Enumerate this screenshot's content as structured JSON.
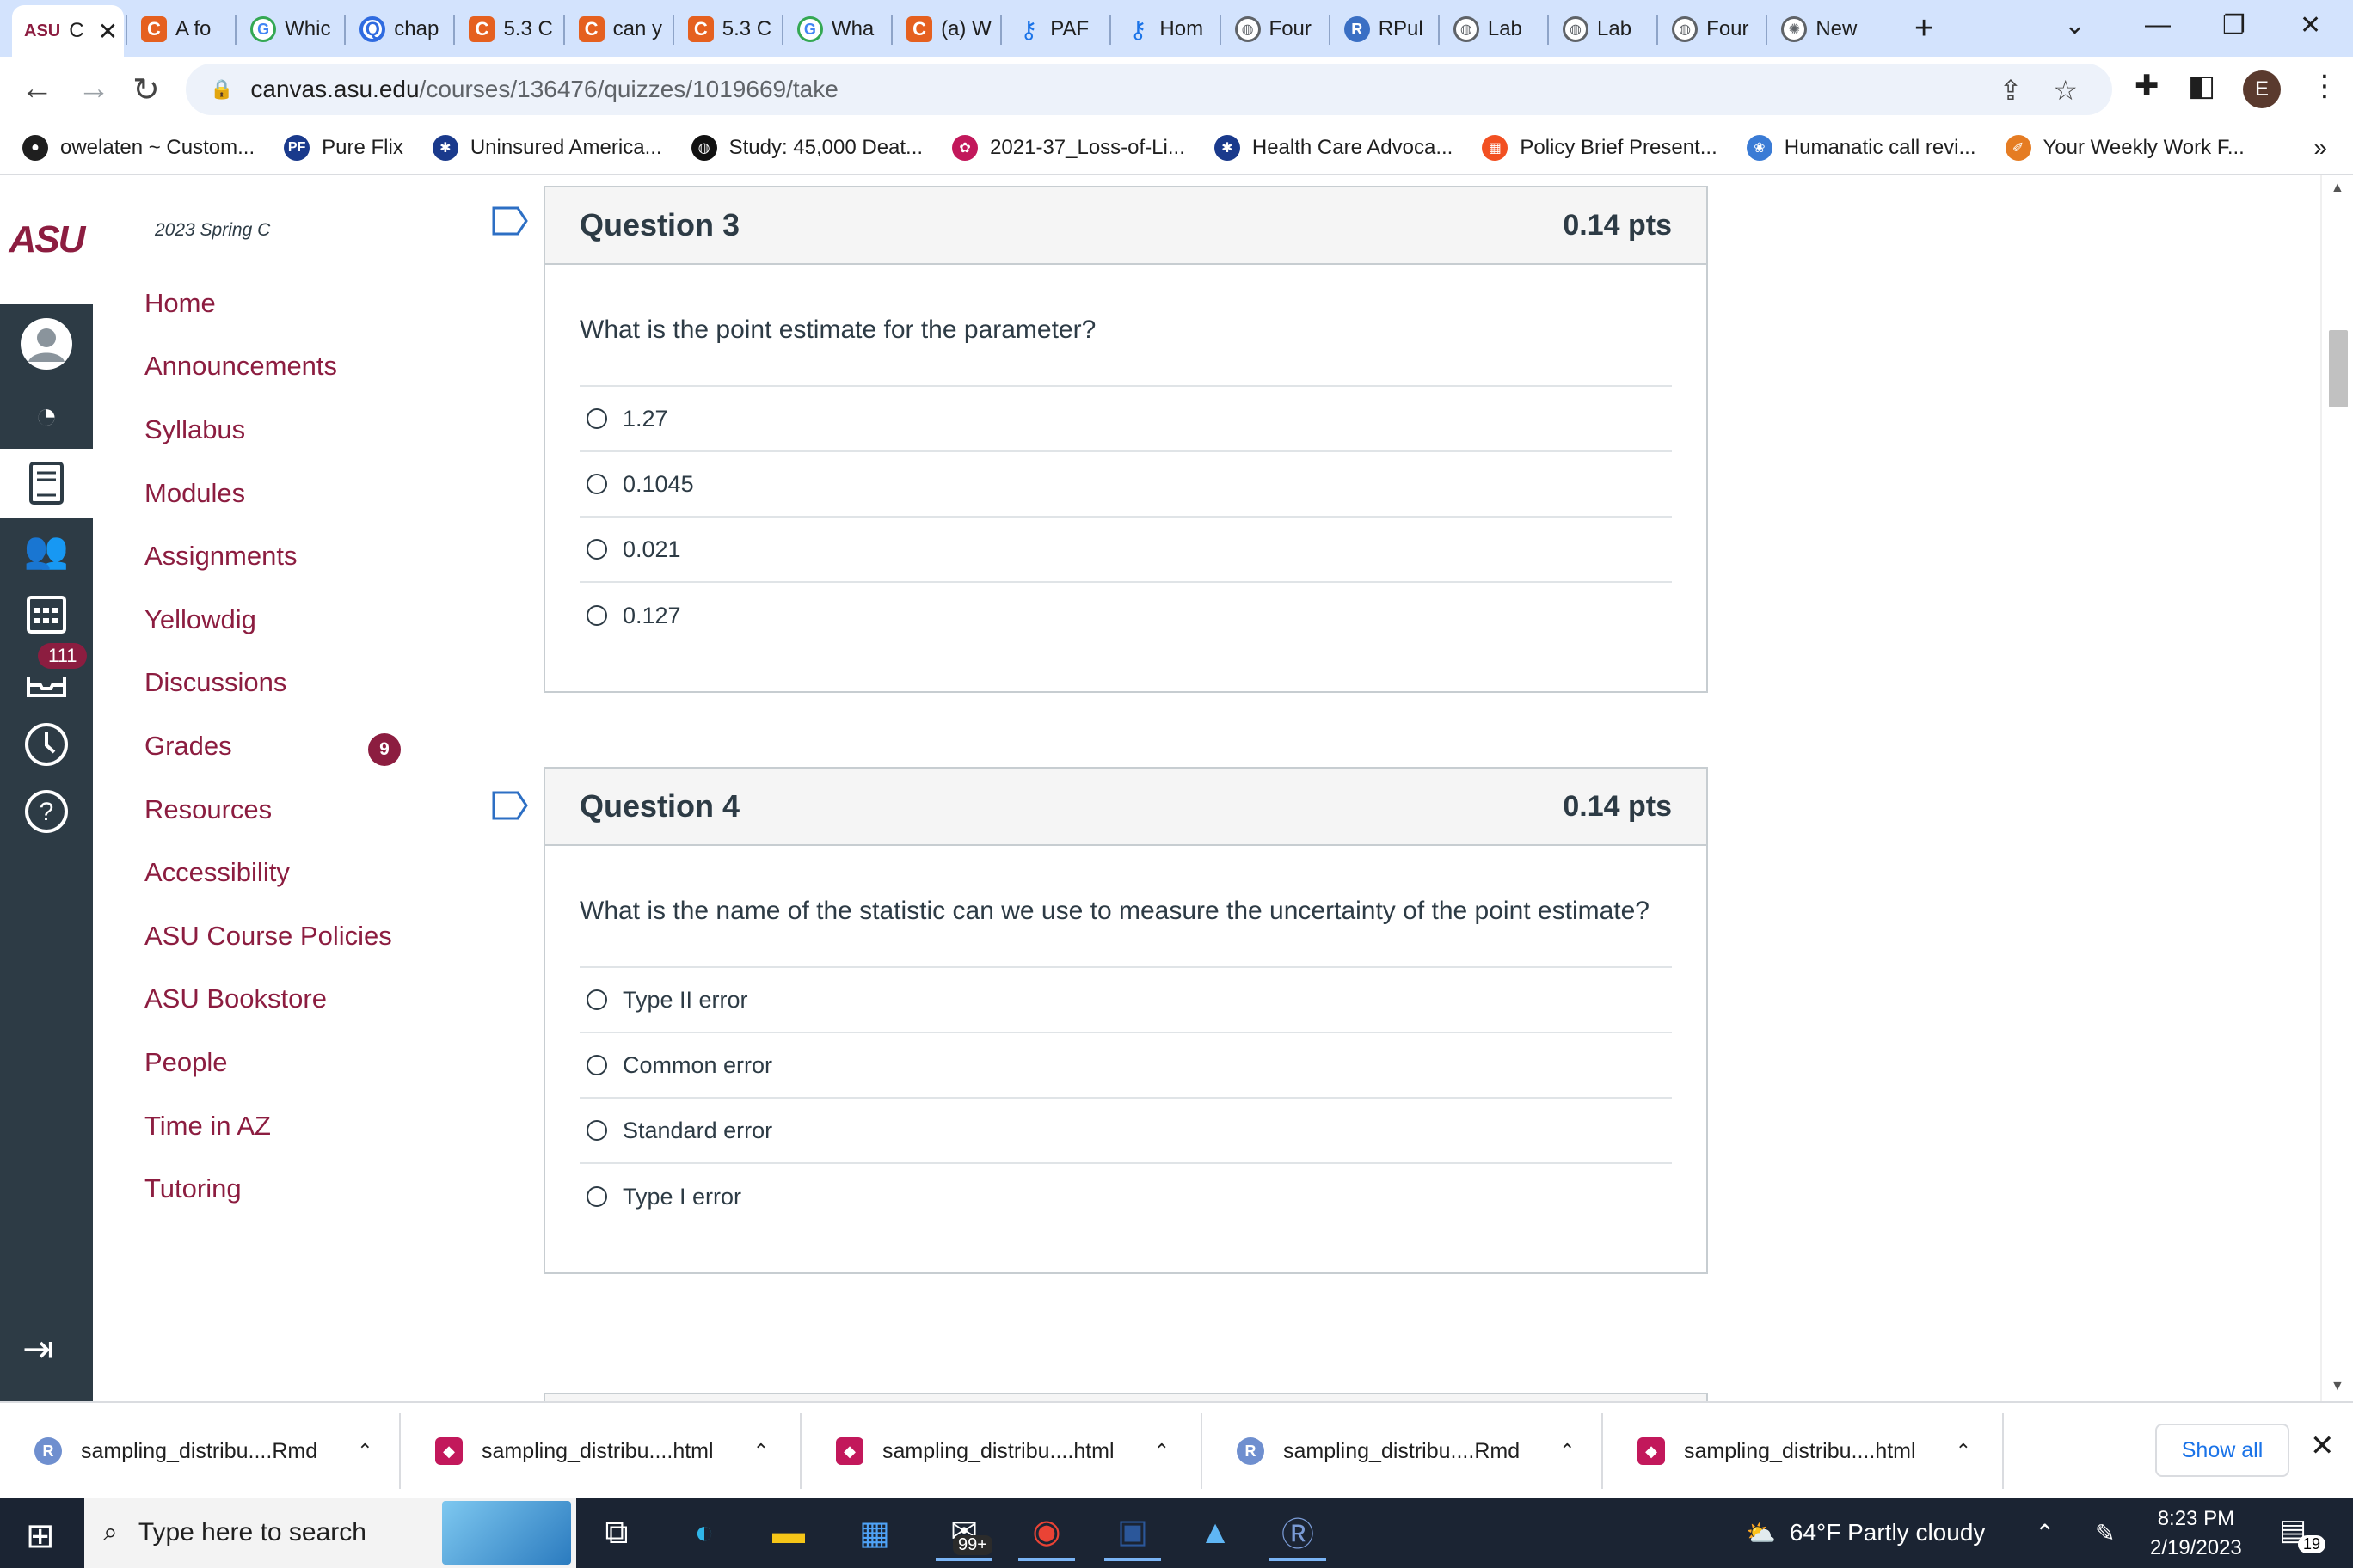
{
  "browser": {
    "tabs": [
      {
        "label": "C",
        "icon": "asu-logo",
        "active": true
      },
      {
        "label": "A fo",
        "icon": "canvas-c"
      },
      {
        "label": "Whic",
        "icon": "google-g"
      },
      {
        "label": "chap",
        "icon": "quizlet-q"
      },
      {
        "label": "5.3 C",
        "icon": "canvas-c"
      },
      {
        "label": "can y",
        "icon": "canvas-c"
      },
      {
        "label": "5.3 C",
        "icon": "canvas-c"
      },
      {
        "label": "Wha",
        "icon": "google-g"
      },
      {
        "label": "(a) W",
        "icon": "canvas-c"
      },
      {
        "label": "PAF",
        "icon": "key-icon"
      },
      {
        "label": "Hom",
        "icon": "key-icon"
      },
      {
        "label": "Four",
        "icon": "globe-icon"
      },
      {
        "label": "RPul",
        "icon": "rpubs-icon"
      },
      {
        "label": "Lab",
        "icon": "globe-icon"
      },
      {
        "label": "Lab",
        "icon": "globe-icon"
      },
      {
        "label": "Four",
        "icon": "globe-icon"
      },
      {
        "label": "New",
        "icon": "chatgpt-icon"
      }
    ],
    "asu_tab_logo": "ASU",
    "url_host": "canvas.asu.edu",
    "url_path": "/courses/136476/quizzes/1019669/take",
    "profile_initial": "E",
    "bookmarks": [
      {
        "label": "owelaten ~ Custom...",
        "icon": "github-icon",
        "color": "#1f1f1f"
      },
      {
        "label": "Pure Flix",
        "icon": "pf-icon",
        "color": "#1a3a8c"
      },
      {
        "label": "Uninsured America...",
        "icon": "snowflake-icon",
        "color": "#1a3a8c"
      },
      {
        "label": "Study: 45,000 Deat...",
        "icon": "globe-dark-icon",
        "color": "#111111"
      },
      {
        "label": "2021-37_Loss-of-Li...",
        "icon": "people-icon",
        "color": "#c2185b"
      },
      {
        "label": "Health Care Advoca...",
        "icon": "snowflake-icon",
        "color": "#1a3a8c"
      },
      {
        "label": "Policy Brief Present...",
        "icon": "microsoft-icon",
        "color": "#f25022"
      },
      {
        "label": "Humanatic call revi...",
        "icon": "brain-icon",
        "color": "#3a7bd5"
      },
      {
        "label": "Your Weekly Work F...",
        "icon": "pencil-icon",
        "color": "#e57c23"
      }
    ]
  },
  "canvas": {
    "logo": "ASU",
    "nav_badge": "111",
    "course_term": "2023 Spring C",
    "course_nav": [
      {
        "label": "Home"
      },
      {
        "label": "Announcements"
      },
      {
        "label": "Syllabus"
      },
      {
        "label": "Modules"
      },
      {
        "label": "Assignments"
      },
      {
        "label": "Yellowdig"
      },
      {
        "label": "Discussions"
      },
      {
        "label": "Grades",
        "badge": "9"
      },
      {
        "label": "Resources"
      },
      {
        "label": "Accessibility"
      },
      {
        "label": "ASU Course Policies"
      },
      {
        "label": "ASU Bookstore"
      },
      {
        "label": "People"
      },
      {
        "label": "Time in AZ"
      },
      {
        "label": "Tutoring"
      }
    ]
  },
  "questions": [
    {
      "title": "Question 3",
      "points": "0.14 pts",
      "text": "What is the point estimate for the parameter?",
      "answers": [
        "1.27",
        "0.1045",
        "0.021",
        "0.127"
      ]
    },
    {
      "title": "Question 4",
      "points": "0.14 pts",
      "text": "What is the name of the statistic can we use to measure the uncertainty of the point estimate?",
      "answers": [
        "Type II error",
        "Common error",
        "Standard error",
        "Type I error"
      ]
    }
  ],
  "downloads": {
    "items": [
      {
        "label": "sampling_distribu....Rmd",
        "type": "rmd"
      },
      {
        "label": "sampling_distribu....html",
        "type": "html"
      },
      {
        "label": "sampling_distribu....html",
        "type": "html"
      },
      {
        "label": "sampling_distribu....Rmd",
        "type": "rmd"
      },
      {
        "label": "sampling_distribu....html",
        "type": "html"
      }
    ],
    "show_all": "Show all"
  },
  "taskbar": {
    "search_placeholder": "Type here to search",
    "mail_badge": "99+",
    "weather": "64°F  Partly cloudy",
    "time": "8:23 PM",
    "date": "2/19/2023",
    "notifications": "19"
  },
  "colors": {
    "asu_maroon": "#8c1d40",
    "canvas_nav": "#2d3b45",
    "tab_strip": "#d3e3fd"
  }
}
